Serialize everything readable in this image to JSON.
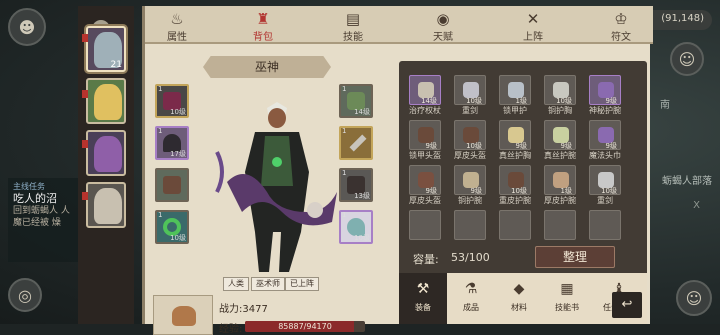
{
  "coins": "(91,148)",
  "map": {
    "label": "蛎蝎人部落",
    "south": "南",
    "x": "X"
  },
  "quest": {
    "type": "主线任务",
    "name": "吃人的沼",
    "desc": "回到蛎蝎人 人魔已经被 燥"
  },
  "chars": [
    {
      "lv": "21",
      "color": "#9fb0b8"
    },
    {
      "lv": "",
      "color": "#e0c060"
    },
    {
      "lv": "",
      "color": "#8f5fa8"
    },
    {
      "lv": "",
      "color": "#c8c0b0"
    }
  ],
  "nav": [
    {
      "label": "属性",
      "icon": "flame"
    },
    {
      "label": "背包",
      "icon": "bag"
    },
    {
      "label": "技能",
      "icon": "book"
    },
    {
      "label": "天赋",
      "icon": "eye"
    },
    {
      "label": "上阵",
      "icon": "swords"
    },
    {
      "label": "符文",
      "icon": "rune"
    }
  ],
  "hero": {
    "name": "巫神",
    "tags": [
      "人类",
      "巫术师",
      "已上阵"
    ],
    "power_label": "战力:",
    "power": "3477",
    "exp_label": "经验:",
    "exp": "85887/94170",
    "exp_fraction": 0.912
  },
  "equip_slots": [
    {
      "n": "10级",
      "q": "1"
    },
    {
      "n": "17级",
      "q": "1"
    },
    {
      "n": "",
      "q": ""
    },
    {
      "n": "10级",
      "q": "1"
    },
    {
      "n": "14级",
      "q": "1"
    },
    {
      "n": "",
      "q": "1"
    },
    {
      "n": "13级",
      "q": "1"
    },
    {
      "n": "10级",
      "q": "1"
    }
  ],
  "items": [
    {
      "name": "治疗权杖",
      "cnt": "14级",
      "style": "rare"
    },
    {
      "name": "重剑",
      "cnt": "10级",
      "style": ""
    },
    {
      "name": "锁甲护",
      "cnt": "1级",
      "style": ""
    },
    {
      "name": "铜护胸",
      "cnt": "10级",
      "style": ""
    },
    {
      "name": "神秘护腕",
      "cnt": "9级",
      "style": "rare"
    },
    {
      "name": "锁甲头盔",
      "cnt": "9级",
      "style": ""
    },
    {
      "name": "厚皮头盔",
      "cnt": "10级",
      "style": ""
    },
    {
      "name": "真丝护胸",
      "cnt": "9级",
      "style": ""
    },
    {
      "name": "真丝护腕",
      "cnt": "9级",
      "style": ""
    },
    {
      "name": "魔法头巾",
      "cnt": "9级",
      "style": ""
    },
    {
      "name": "厚皮头盔",
      "cnt": "9级",
      "style": ""
    },
    {
      "name": "铜护腕",
      "cnt": "9级",
      "style": ""
    },
    {
      "name": "重皮护腕",
      "cnt": "10级",
      "style": ""
    },
    {
      "name": "厚皮护腕",
      "cnt": "1级",
      "style": ""
    },
    {
      "name": "重剑",
      "cnt": "10级",
      "style": ""
    },
    {
      "name": "",
      "cnt": "",
      "style": ""
    },
    {
      "name": "",
      "cnt": "",
      "style": ""
    },
    {
      "name": "",
      "cnt": "",
      "style": ""
    },
    {
      "name": "",
      "cnt": "",
      "style": ""
    },
    {
      "name": "",
      "cnt": "",
      "style": ""
    }
  ],
  "capacity": {
    "label": "容量:",
    "value": "53/100"
  },
  "sort_label": "整理",
  "bottom_tabs": [
    {
      "label": "装备",
      "icon": "hammer"
    },
    {
      "label": "成品",
      "icon": "flask"
    },
    {
      "label": "材料",
      "icon": "ore"
    },
    {
      "label": "技能书",
      "icon": "scroll"
    },
    {
      "label": "任务物品",
      "icon": "pouch"
    }
  ],
  "back_label": "↩"
}
